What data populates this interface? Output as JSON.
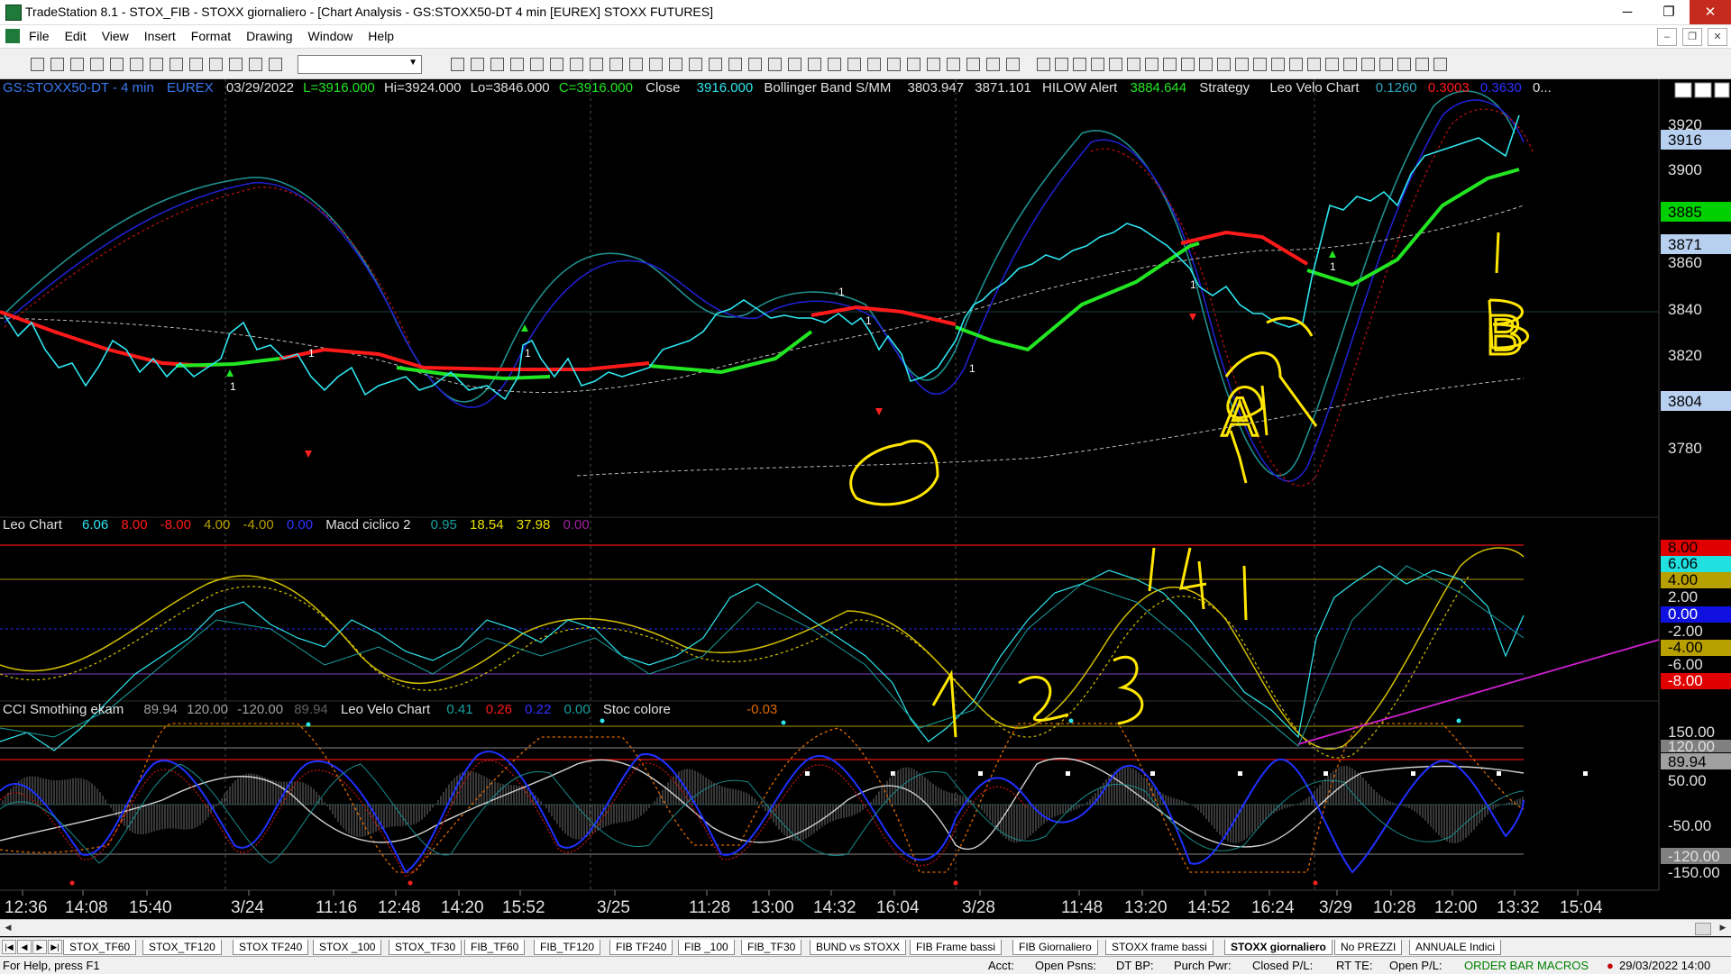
{
  "window": {
    "title": "TradeStation 8.1 - STOX_FIB - STOXX giornaliero - [Chart Analysis - GS:STOXX50-DT  4 min  [EUREX] STOXX FUTURES]",
    "buttons": [
      "─",
      "❐",
      "✕"
    ]
  },
  "menu": [
    "File",
    "Edit",
    "View",
    "Insert",
    "Format",
    "Drawing",
    "Window",
    "Help"
  ],
  "mdi_buttons": [
    "–",
    "❐",
    "✕"
  ],
  "chart": {
    "header": {
      "symbol": "GS:STOXX50-DT - 4 min",
      "exchange": "EUREX",
      "date": "03/29/2022",
      "last": "L=3916.000",
      "hi": "Hi=3924.000",
      "lo": "Lo=3846.000",
      "close_c": "C=3916.000",
      "close_label": "Close",
      "close_val": "3916.000",
      "boll_label": "Bollinger Band S/MM",
      "boll_v1": "3803.947",
      "boll_v2": "3871.101",
      "hilow_label": "HILOW Alert",
      "hilow_v": "3884.644",
      "strategy": "Strategy",
      "leovelo_label": "Leo Velo Chart",
      "lv1": "0.1260",
      "lv2": "0.3003",
      "lv3": "0.3630",
      "more": "0..."
    },
    "price_axis": {
      "ticks": [
        "3920",
        "3900",
        "3880",
        "3860",
        "3840",
        "3820",
        "3800",
        "3780"
      ],
      "badges": [
        {
          "text": "3916",
          "bg": "#b8d0f0",
          "fg": "#000"
        },
        {
          "text": "3885",
          "bg": "#00d000",
          "fg": "#000"
        },
        {
          "text": "3871",
          "bg": "#b8d0f0",
          "fg": "#000"
        },
        {
          "text": "3804",
          "bg": "#b8d0f0",
          "fg": "#000"
        }
      ]
    },
    "panel2_header": {
      "label1": "Leo Chart",
      "v1": "6.06",
      "v2": "8.00",
      "v3": "-8.00",
      "v4": "4.00",
      "v5": "-4.00",
      "v6": "0.00",
      "label2": "Macd ciclico 2",
      "m1": "0.95",
      "m2": "18.54",
      "m3": "37.98",
      "m4": "0.00"
    },
    "panel2_axis": {
      "ticks": [
        "8.00",
        "6.06",
        "4.00",
        "2.00",
        "0.00",
        "-2.00",
        "-4.00",
        "-6.00",
        "-8.00"
      ],
      "badges": [
        {
          "text": "8.00",
          "bg": "#e00000",
          "fg": "#000"
        },
        {
          "text": "6.06",
          "bg": "#20e0e0",
          "fg": "#000"
        },
        {
          "text": "4.00",
          "bg": "#b8a000",
          "fg": "#000"
        },
        {
          "text": "0.00",
          "bg": "#1010e0",
          "fg": "#fff"
        },
        {
          "text": "-4.00",
          "bg": "#b8a000",
          "fg": "#000"
        },
        {
          "text": "-8.00",
          "bg": "#e00000",
          "fg": "#fff"
        }
      ]
    },
    "panel3_header": {
      "label1": "CCI Smothing ekam",
      "c1": "89.94",
      "c2": "120.00",
      "c3": "-120.00",
      "c4": "89.94",
      "label2": "Leo Velo Chart",
      "l1": "0.41",
      "l2": "0.26",
      "l3": "0.22",
      "l4": "0.00",
      "label3": "Stoc colore",
      "s1": "-0.03"
    },
    "panel3_axis": {
      "ticks": [
        "150.00",
        "120.00",
        "89.94",
        "50.00",
        "-50.00",
        "-120.00",
        "-150.00"
      ]
    },
    "time_axis": [
      "12:36",
      "14:08",
      "15:40",
      "3/24",
      "11:16",
      "12:48",
      "14:20",
      "15:52",
      "3/25",
      "11:28",
      "13:00",
      "14:32",
      "16:04",
      "3/28",
      "11:48",
      "13:20",
      "14:52",
      "16:24",
      "3/29",
      "10:28",
      "12:00",
      "13:32",
      "15:04"
    ],
    "annotations": {
      "a_label": "A",
      "b_label": "B",
      "one": "1",
      "nums": [
        "1",
        "2",
        "3"
      ],
      "tag_141": "141"
    },
    "markers": [
      "1",
      "-1",
      "1",
      "1",
      "1",
      "1",
      "1",
      "1"
    ]
  },
  "tabs": [
    "STOX_TF60",
    "STOX_TF120",
    "STOX TF240",
    "STOX _100",
    "STOX_TF30",
    "FIB_TF60",
    "FIB_TF120",
    "FIB TF240",
    "FIB _100",
    "FIB_TF30",
    "BUND vs STOXX",
    "FIB Frame bassi",
    "FIB Giornaliero",
    "STOXX frame bassi",
    "STOXX giornaliero",
    "No PREZZI",
    "ANNUALE Indici"
  ],
  "active_tab": "STOXX giornaliero",
  "status": {
    "help": "For Help, press F1",
    "acct": "Acct:",
    "open_psns": "Open Psns:",
    "dt_bp": "DT BP:",
    "purch_pwr": "Purch Pwr:",
    "closed_pl": "Closed P/L:",
    "rt_te": "RT TE:",
    "open_pl": "Open P/L:",
    "order_bar": "ORDER BAR",
    "macros": "MACROS",
    "datetime": "29/03/2022 14:00"
  },
  "colors": {
    "background": "#000000",
    "price_line": "#2ee6f0",
    "boll_red": "#ff1a1a",
    "boll_green": "#22e622",
    "annotation": "#ffe600"
  }
}
